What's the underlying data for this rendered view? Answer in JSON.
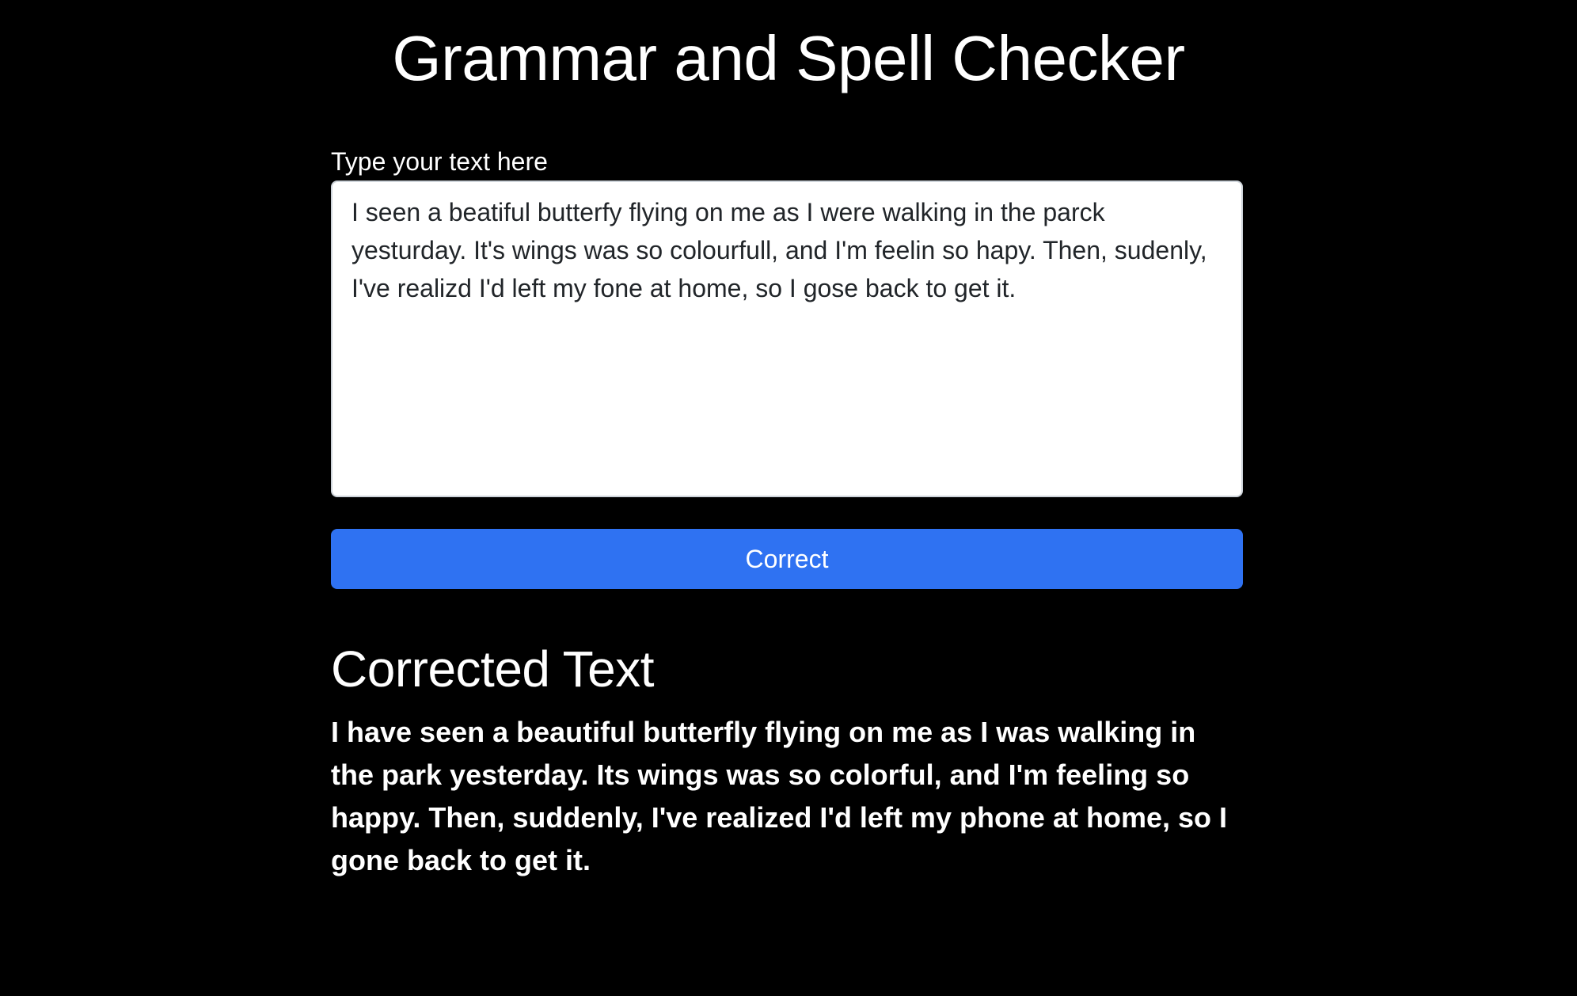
{
  "page": {
    "title": "Grammar and Spell Checker"
  },
  "input": {
    "label": "Type your text here",
    "value": "I seen a beatiful butterfy flying on me as I were walking in the parck yesturday. It's wings was so colourfull, and I'm feelin so hapy. Then, sudenly, I've realizd I'd left my fone at home, so I gose back to get it.",
    "placeholder": ""
  },
  "actions": {
    "correct_label": "Correct"
  },
  "result": {
    "heading": "Corrected Text",
    "text": "I have seen a beautiful butterfly flying on me as I was walking in the park yesterday. Its wings was so colorful, and I'm feeling so happy. Then, suddenly, I've realized I'd left my phone at home, so I gone back to get it."
  },
  "colors": {
    "background": "#000000",
    "text": "#ffffff",
    "button": "#2f72f2",
    "textarea_background": "#ffffff",
    "textarea_text": "#212529"
  }
}
